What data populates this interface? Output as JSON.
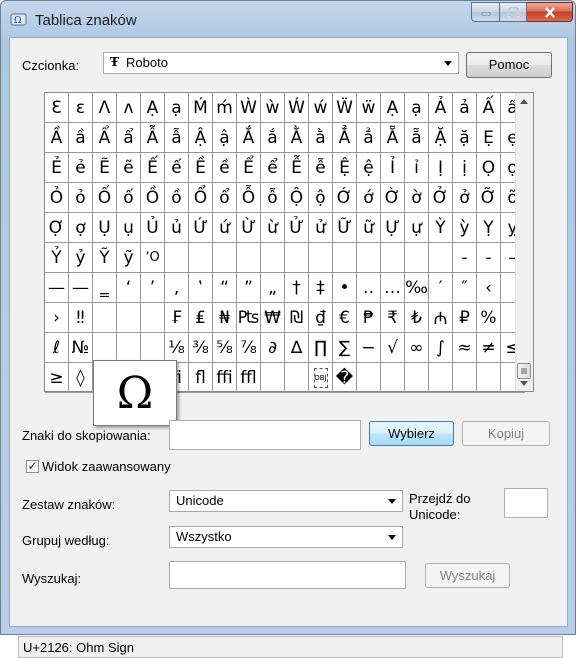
{
  "window": {
    "title": "Tablica znaków"
  },
  "font_label": "Czcionka:",
  "font_selected": "Roboto",
  "font_icon": "truetype-font-icon",
  "help_button": "Pomoc",
  "grid": {
    "rows": [
      [
        "Ɛ",
        "ɛ",
        "Ʌ",
        "ʌ",
        "Ạ",
        "ạ",
        "Ḿ",
        "ḿ",
        "Ẁ",
        "ẁ",
        "Ẃ",
        "ẃ",
        "Ẅ",
        "ẅ",
        "Ạ",
        "ạ",
        "Ả",
        "ả",
        "Ấ",
        "ấ"
      ],
      [
        "Ầ",
        "ầ",
        "Ẩ",
        "ẩ",
        "Ẫ",
        "ẫ",
        "Ậ",
        "ậ",
        "Ắ",
        "ắ",
        "Ằ",
        "ằ",
        "Ẳ",
        "ẳ",
        "Ẵ",
        "ẵ",
        "Ặ",
        "ặ",
        "Ẹ",
        "ẹ"
      ],
      [
        "Ẻ",
        "ẻ",
        "Ẽ",
        "ẽ",
        "Ế",
        "ế",
        "Ề",
        "ề",
        "Ể",
        "ể",
        "Ễ",
        "ễ",
        "Ệ",
        "ệ",
        "Ỉ",
        "ỉ",
        "Ị",
        "ị",
        "Ọ",
        "ọ"
      ],
      [
        "Ỏ",
        "ỏ",
        "Ố",
        "ố",
        "Ồ",
        "ồ",
        "Ổ",
        "ổ",
        "Ỗ",
        "ỗ",
        "Ộ",
        "ộ",
        "Ớ",
        "ớ",
        "Ờ",
        "ờ",
        "Ở",
        "ở",
        "Ỡ",
        "ỡ"
      ],
      [
        "Ợ",
        "ợ",
        "Ụ",
        "ụ",
        "Ủ",
        "ủ",
        "Ứ",
        "ứ",
        "Ừ",
        "ừ",
        "Ử",
        "ử",
        "Ữ",
        "ữ",
        "Ự",
        "ự",
        "Ỳ",
        "ỳ",
        "Ỵ",
        "ỵ"
      ],
      [
        "Ỷ",
        "ỷ",
        "Ỹ",
        "ỹ",
        "ʼO",
        "",
        "",
        "",
        "",
        "",
        "",
        "",
        "",
        "",
        "",
        "",
        "",
        "-",
        "-",
        "–"
      ],
      [
        "—",
        "—",
        "‗",
        "‘",
        "’",
        "‚",
        "‛",
        "“",
        "”",
        "„",
        "†",
        "‡",
        "•",
        "‥",
        "…",
        "‰",
        "′",
        "″",
        "‹",
        ""
      ],
      [
        "›",
        "‼",
        "",
        "",
        "",
        "₣",
        "₤",
        "₦",
        "₧",
        "₩",
        "₪",
        "₫",
        "€",
        "₱",
        "₹",
        "₺",
        "₼",
        "₽",
        "%",
        ""
      ],
      [
        "ℓ",
        "№",
        "",
        "",
        "",
        "⅛",
        "⅜",
        "⅝",
        "⅞",
        "∂",
        "∆",
        "∏",
        "∑",
        "−",
        "√",
        "∞",
        "∫",
        "≈",
        "≠",
        "≤"
      ],
      [
        "≥",
        "◊",
        "",
        "",
        "",
        "ﬁ",
        "ﬂ",
        "ﬃ",
        "ﬄ",
        "",
        "",
        "OBJ",
        "�",
        "",
        "",
        "",
        "",
        "",
        "",
        ""
      ]
    ],
    "selected_char": "Ω"
  },
  "copy_label": "Znaki do skopiowania:",
  "copy_value": "",
  "select_button": "Wybierz",
  "copy_button": "Kopiuj",
  "advanced_checkbox": {
    "label": "Widok zaawansowany",
    "checked": true
  },
  "charset_label": "Zestaw znaków:",
  "charset_value": "Unicode",
  "goto_label_1": "Przejdź do",
  "goto_label_2": "Unicode:",
  "goto_value": "",
  "group_label": "Grupuj według:",
  "group_value": "Wszystko",
  "search_label": "Wyszukaj:",
  "search_value": "",
  "search_button": "Wyszukaj",
  "status": "U+2126: Ohm Sign"
}
